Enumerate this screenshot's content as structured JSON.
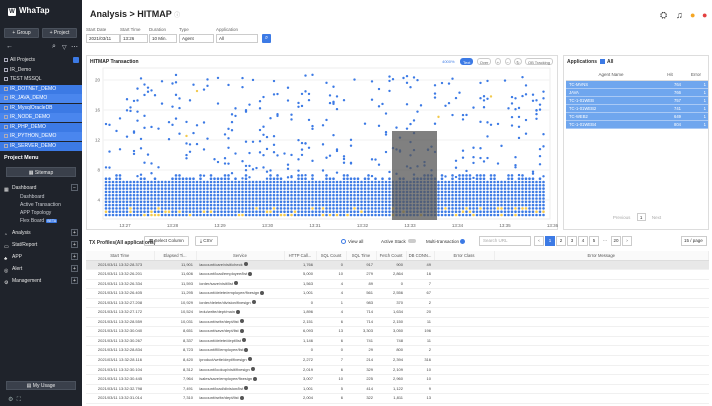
{
  "app": {
    "brand": "WhaTap"
  },
  "sidebar": {
    "group_button": "+ Group",
    "project_button": "+ Project",
    "projects": [
      {
        "label": "All Projects",
        "selected": false
      },
      {
        "label": "IR_Demo",
        "selected": false
      },
      {
        "label": "TEST MSSQL",
        "selected": false
      },
      {
        "label": "IR_DOTNET_DEMO",
        "selected": true
      },
      {
        "label": "IR_JAVA_DEMO",
        "selected": true
      },
      {
        "label": "IR_MysqlOracleDB",
        "selected": true
      },
      {
        "label": "IR_NODE_DEMO",
        "selected": true
      },
      {
        "label": "IR_PHP_DEMO",
        "selected": true
      },
      {
        "label": "IR_PYTHON_DEMO",
        "selected": true
      },
      {
        "label": "IR_SERVER_DEMO",
        "selected": true
      }
    ],
    "menu_title": "Project Menu",
    "sitemap": "Sitemap",
    "menus": [
      {
        "label": "Dashboard",
        "toggle": "−"
      },
      {
        "label": "Analysis",
        "toggle": "+"
      },
      {
        "label": "Stat/Report",
        "toggle": "+"
      },
      {
        "label": "APP",
        "toggle": "+"
      },
      {
        "label": "Alert",
        "toggle": "+"
      },
      {
        "label": "Management",
        "toggle": "+"
      }
    ],
    "dashboard_sub": [
      "Dashboard",
      "Active Transaction",
      "APP Topology",
      "Flex Board"
    ],
    "beta": "BETA",
    "my_usage": "My Usage"
  },
  "header": {
    "title": "Analysis > HITMAP",
    "filters": [
      {
        "label": "Start Date",
        "value": "2021/03/11"
      },
      {
        "label": "Start Time",
        "value": "13:26"
      },
      {
        "label": "Duration",
        "value": "10 Min."
      },
      {
        "label": "Type",
        "value": "Agent"
      },
      {
        "label": "Application",
        "value": "All"
      }
    ]
  },
  "hitmap": {
    "title": "HITMAP Transaction",
    "legend": "4000%",
    "controls": [
      "Text",
      "Over",
      "OB Tracking"
    ],
    "y_ticks": [
      "20",
      "16",
      "12",
      "8",
      "4"
    ],
    "x_ticks": [
      "13:27",
      "13:28",
      "13:29",
      "13:30",
      "13:31",
      "13:32",
      "13:33",
      "13:34",
      "13:35",
      "13:36"
    ],
    "colors": {
      "normal": "#3c7ae5",
      "warn": "#f2c94c",
      "selection": "#555555"
    }
  },
  "applications": {
    "title": "Applications",
    "all_label": "All",
    "columns": [
      "Agent Name",
      "Hit",
      "Error"
    ],
    "rows": [
      {
        "name": "TC-MVNS",
        "hit": "764",
        "err": "1"
      },
      {
        "name": "JAVA",
        "hit": "766",
        "err": "1"
      },
      {
        "name": "TC-1-01WEB",
        "hit": "757",
        "err": "1"
      },
      {
        "name": "TC-1-01WEB2",
        "hit": "741",
        "err": "1"
      },
      {
        "name": "TC-WEB2",
        "hit": "649",
        "err": "1"
      },
      {
        "name": "TC-1-01WEB4",
        "hit": "804",
        "err": "1"
      }
    ],
    "prev": "Previous",
    "page": "1",
    "next": "Next"
  },
  "tx": {
    "title": "TX Profiles(All applications)",
    "select_columns": "Select Column",
    "csv": "CSV",
    "view_all": "View all",
    "active_stack": "Active Stack",
    "multi_tx": "Multi-transaction",
    "search_placeholder": "Search URL",
    "pages": [
      "1",
      "2",
      "3",
      "4",
      "5",
      "...",
      "20"
    ],
    "per_page": "15 / page",
    "columns": [
      "Start Time",
      "Elapsed Ti...",
      "Service",
      "HTTP Call...",
      "SQL Count",
      "SQL Time",
      "Fetch Count",
      "DB CONN...",
      "Error Class",
      "Error Message"
    ],
    "rows": [
      [
        "2021/03/11 13:32:28.373",
        "11,901",
        "/account/care/visit/check",
        "1,766",
        "0",
        "917",
        "900",
        "49"
      ],
      [
        "2021/03/11 13:32:26.201",
        "11,606",
        "/account/load/employee/list",
        "5,000",
        "10",
        "279",
        "2,864",
        "16"
      ],
      [
        "2021/03/11 13:32:26.334",
        "11,593",
        "/order/save/visit/list",
        "1,563",
        "4",
        "89",
        "0",
        "7"
      ],
      [
        "2021/03/11 13:32:26.405",
        "11,295",
        "/account/delete/employee/fixesign",
        "1,001",
        "4",
        "561",
        "2,556",
        "67"
      ],
      [
        "2021/03/11 13:32:27.208",
        "10,929",
        "/order/delete/division/fixesign",
        "0",
        "1",
        "983",
        "370",
        "2"
      ],
      [
        "2021/03/11 13:32:27.172",
        "10,524",
        "/edu/write/dept/main",
        "1,896",
        "4",
        "714",
        "1,634",
        "20"
      ],
      [
        "2021/03/11 13:32:28.559",
        "10,031",
        "/account/write/dept/list",
        "2,151",
        "6",
        "714",
        "2,150",
        "11"
      ],
      [
        "2021/03/11 13:32:30.040",
        "8,651",
        "/account/save/dept/list",
        "6,093",
        "13",
        "3,303",
        "3,050",
        "196"
      ],
      [
        "2021/03/11 13:32:30.267",
        "8,337",
        "/account/delete/dept/list",
        "1,146",
        "6",
        "741",
        "748",
        "11"
      ],
      [
        "2021/03/11 13:32:28.834",
        "8,723",
        "/account/fill/employee/list",
        "0",
        "0",
        "29",
        "800",
        "2"
      ],
      [
        "2021/03/11 13:32:28.116",
        "8,420",
        "/product/write/dept/fixesign",
        "2,272",
        "7",
        "214",
        "2,394",
        "316"
      ],
      [
        "2021/03/11 13:32:30.104",
        "8,312",
        "/account/lookup/visit/fixesign",
        "2,019",
        "6",
        "329",
        "2,109",
        "10"
      ],
      [
        "2021/03/11 13:32:30.445",
        "7,964",
        "/sales/save/employee/fixesign",
        "3,007",
        "10",
        "225",
        "2,960",
        "10"
      ],
      [
        "2021/03/11 13:32:32.798",
        "7,491",
        "/account/load/division/list",
        "1,001",
        "5",
        "414",
        "1,122",
        "9"
      ],
      [
        "2021/03/11 13:32:31.014",
        "7,310",
        "/account/write/dept/list",
        "2,004",
        "6",
        "322",
        "1,811",
        "13"
      ]
    ]
  }
}
